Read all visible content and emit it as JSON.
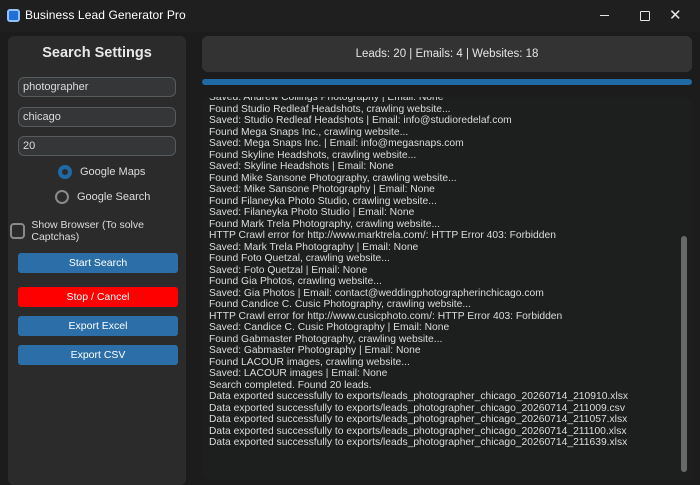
{
  "window": {
    "title": "Business Lead Generator Pro",
    "min_glyph": "",
    "max_glyph": "",
    "close_glyph": "✕"
  },
  "sidebar": {
    "title": "Search Settings",
    "keyword_value": "photographer",
    "location_value": "chicago",
    "count_value": "20",
    "radio_google_maps": "Google Maps",
    "radio_google_search": "Google Search",
    "selected_source": "Google Maps",
    "show_browser_label": "Show Browser (To solve Captchas)",
    "show_browser_checked": false,
    "start_label": "Start Search",
    "stop_label": "Stop / Cancel",
    "export_excel_label": "Export Excel",
    "export_csv_label": "Export CSV"
  },
  "stats": {
    "text": "Leads: 20 | Emails: 4 | Websites: 18"
  },
  "progress": {
    "fraction": 1.0
  },
  "log": {
    "lines": [
      "Saved: Andrew Collings Photography | Email: None",
      "Found Studio Redleaf Headshots, crawling website...",
      "Saved: Studio Redleaf Headshots | Email: info@studioredelaf.com",
      "Found Mega Snaps Inc., crawling website...",
      "Saved: Mega Snaps Inc. | Email: info@megasnaps.com",
      "Found Skyline Headshots, crawling website...",
      "Saved: Skyline Headshots | Email: None",
      "Found Mike Sansone Photography, crawling website...",
      "Saved: Mike Sansone Photography | Email: None",
      "Found Filaneyka Photo Studio, crawling website...",
      "Saved: Filaneyka Photo Studio | Email: None",
      "Found Mark Trela Photography, crawling website...",
      "HTTP Crawl error for http://www.marktrela.com/: HTTP Error 403: Forbidden",
      "Saved: Mark Trela Photography | Email: None",
      "Found Foto Quetzal, crawling website...",
      "Saved: Foto Quetzal | Email: None",
      "Found Gia Photos, crawling website...",
      "Saved: Gia Photos | Email: contact@weddingphotographerinchicago.com",
      "Found Candice C. Cusic Photography, crawling website...",
      "HTTP Crawl error for http://www.cusicphoto.com/: HTTP Error 403: Forbidden",
      "Saved: Candice C. Cusic Photography | Email: None",
      "Found Gabmaster Photography, crawling website...",
      "Saved: Gabmaster Photography | Email: None",
      "Found LACOUR images, crawling website...",
      "Saved: LACOUR images | Email: None",
      "Search completed. Found 20 leads.",
      "Data exported successfully to exports/leads_photographer_chicago_20260714_210910.xlsx",
      "Data exported successfully to exports/leads_photographer_chicago_20260714_211009.csv",
      "Data exported successfully to exports/leads_photographer_chicago_20260714_211057.xlsx",
      "Data exported successfully to exports/leads_photographer_chicago_20260714_211100.xlsx",
      "Data exported successfully to exports/leads_photographer_chicago_20260714_211639.xlsx"
    ]
  },
  "colors": {
    "accent": "#1f6aa5",
    "button_blue": "#2b6ea8",
    "stop_red": "#ff0000",
    "background": "#1c1c1c"
  }
}
